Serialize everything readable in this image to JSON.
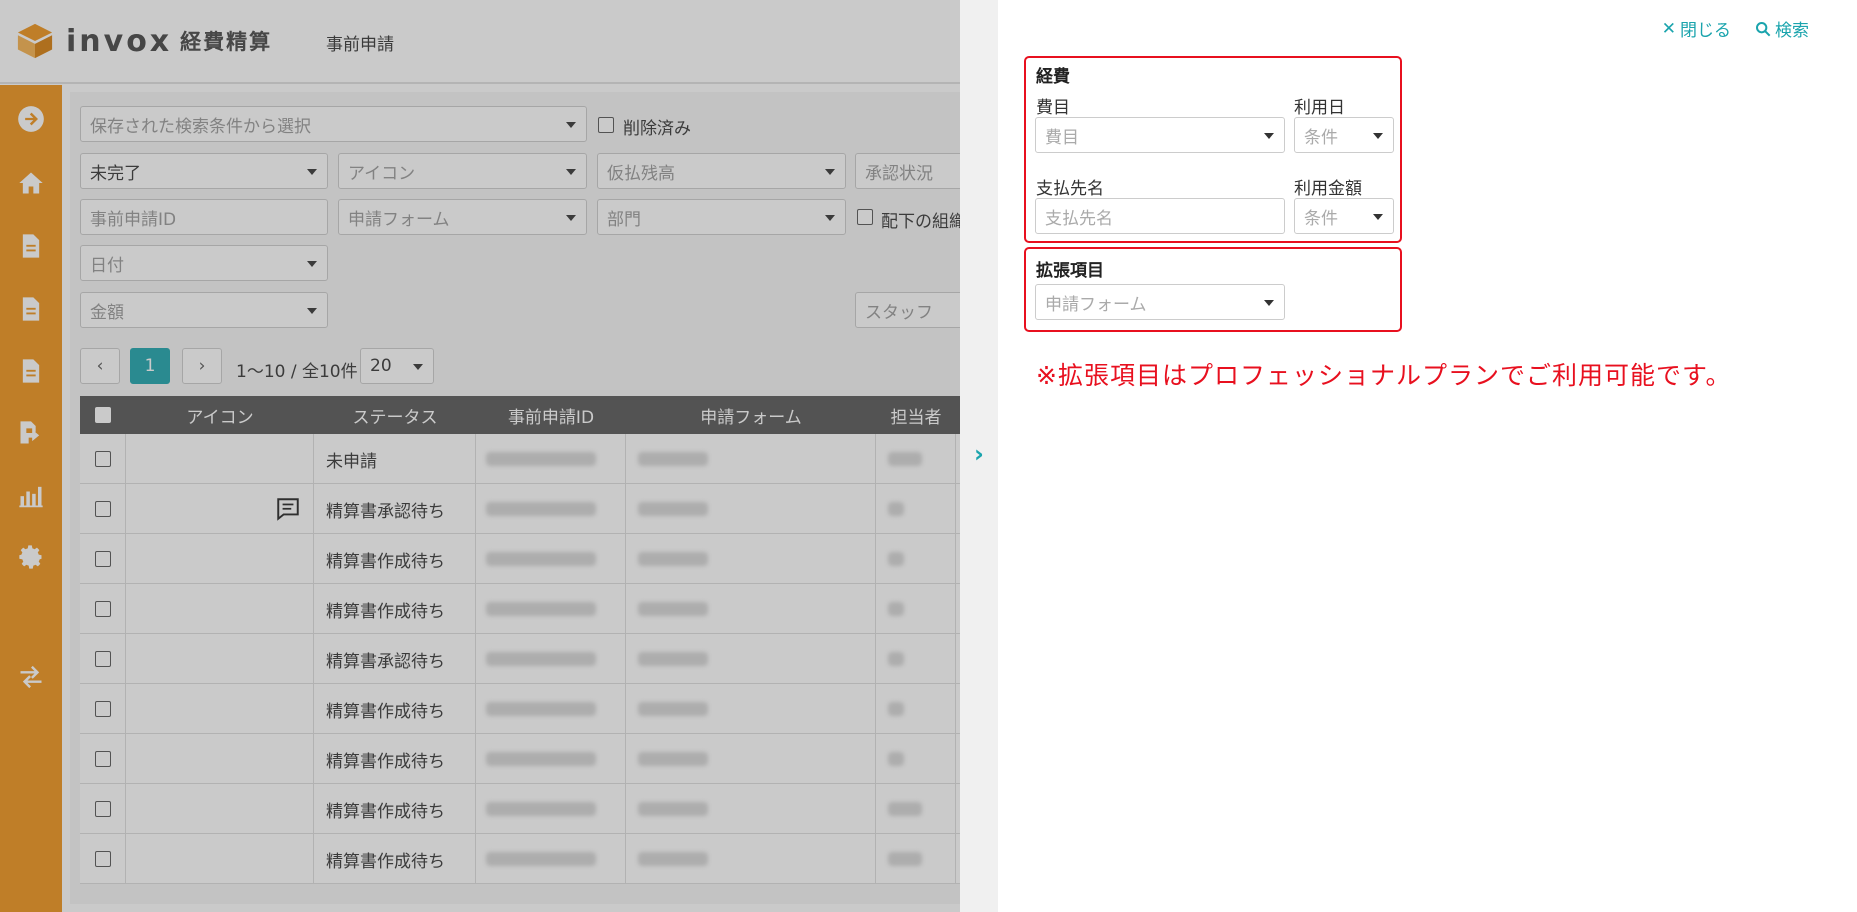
{
  "app": {
    "logo_text": "invox",
    "logo_sub": "経費精算",
    "page_title": "事前申請"
  },
  "filters": {
    "saved_search_placeholder": "保存された検索条件から選択",
    "deleted_label": "削除済み",
    "status_value": "未完了",
    "icon_placeholder": "アイコン",
    "advance_balance_placeholder": "仮払残高",
    "approval_status_placeholder": "承認状況",
    "pre_request_id_placeholder": "事前申請ID",
    "form_placeholder": "申請フォーム",
    "department_placeholder": "部門",
    "subordinate_org_label": "配下の組織",
    "date_placeholder": "日付",
    "amount_placeholder": "金額",
    "staff_placeholder": "スタッフ"
  },
  "pagination": {
    "current_page": "1",
    "range_text": "1〜10 / 全10件",
    "per_page": "20"
  },
  "table": {
    "columns": [
      "アイコン",
      "ステータス",
      "事前申請ID",
      "申請フォーム",
      "担当者"
    ],
    "rows": [
      {
        "status": "未申請",
        "has_comment_icon": false
      },
      {
        "status": "精算書承認待ち",
        "has_comment_icon": true
      },
      {
        "status": "精算書作成待ち",
        "has_comment_icon": false
      },
      {
        "status": "精算書作成待ち",
        "has_comment_icon": false
      },
      {
        "status": "精算書承認待ち",
        "has_comment_icon": false
      },
      {
        "status": "精算書作成待ち",
        "has_comment_icon": false
      },
      {
        "status": "精算書作成待ち",
        "has_comment_icon": false
      },
      {
        "status": "精算書作成待ち",
        "has_comment_icon": false
      },
      {
        "status": "精算書作成待ち",
        "has_comment_icon": false
      }
    ]
  },
  "panel": {
    "close_label": "閉じる",
    "search_label": "検索",
    "expense_section_title": "経費",
    "expense_item_label": "費目",
    "expense_item_placeholder": "費目",
    "usage_date_label": "利用日",
    "usage_date_placeholder": "条件",
    "payee_label": "支払先名",
    "payee_placeholder": "支払先名",
    "usage_amount_label": "利用金額",
    "usage_amount_placeholder": "条件",
    "extension_section_title": "拡張項目",
    "extension_form_placeholder": "申請フォーム",
    "notice": "※拡張項目はプロフェッショナルプランでご利用可能です。"
  },
  "colors": {
    "sidebar": "#ef9318",
    "accent": "#1aa4ad",
    "highlight_red": "#e8101f"
  },
  "icons": {
    "sidebar": [
      "arrow-right-circle-icon",
      "home-icon",
      "document-icon",
      "document-icon",
      "document-icon",
      "document-export-icon",
      "chart-icon",
      "gear-icon",
      "transfer-icon"
    ]
  }
}
